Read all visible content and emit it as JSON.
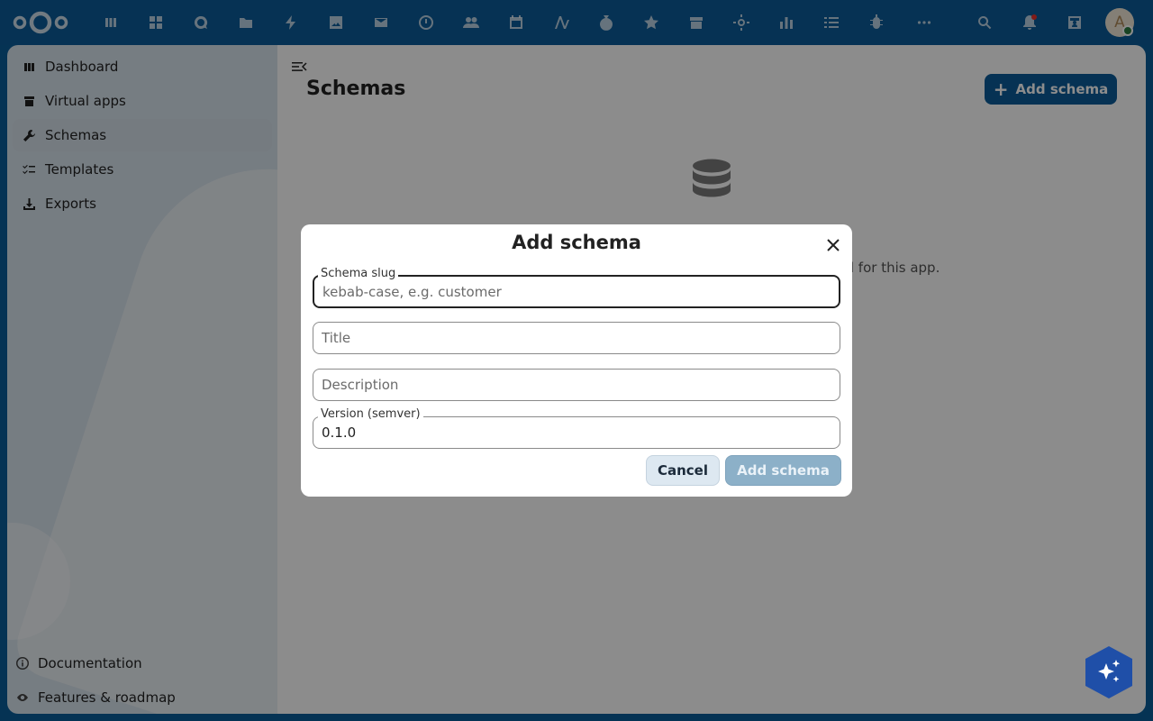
{
  "topbar": {
    "apps": [
      "apps-icon",
      "dashboard-icon",
      "talk-icon",
      "files-icon",
      "activity-icon",
      "photos-icon",
      "mail-icon",
      "deck-icon",
      "contacts-icon",
      "calendar-icon",
      "forms-icon",
      "money-icon",
      "favorites-icon",
      "archive-icon",
      "settings-gear-icon",
      "analytics-icon",
      "tasks-icon",
      "bug-icon",
      "more-icon"
    ],
    "avatar_letter": "A"
  },
  "sidebar": {
    "items": [
      {
        "label": "Dashboard",
        "icon": "dashboard-icon"
      },
      {
        "label": "Virtual apps",
        "icon": "archive-icon"
      },
      {
        "label": "Schemas",
        "icon": "wrench-icon"
      },
      {
        "label": "Templates",
        "icon": "checklist-icon"
      },
      {
        "label": "Exports",
        "icon": "download-icon"
      }
    ],
    "footer": [
      {
        "label": "Documentation",
        "icon": "info-icon"
      },
      {
        "label": "Features & roadmap",
        "icon": "eye-icon"
      }
    ]
  },
  "main": {
    "title": "Schemas",
    "add_button": "Add schema",
    "empty_text_visible": "el for this app."
  },
  "dialog": {
    "title": "Add schema",
    "fields": {
      "slug": {
        "label": "Schema slug",
        "placeholder": "kebab-case, e.g. customer",
        "value": ""
      },
      "title": {
        "placeholder": "Title",
        "value": ""
      },
      "description": {
        "placeholder": "Description",
        "value": ""
      },
      "version": {
        "label": "Version (semver)",
        "value": "0.1.0"
      }
    },
    "cancel_label": "Cancel",
    "submit_label": "Add schema"
  },
  "colors": {
    "brand": "#0b5c99",
    "overlay": "rgba(0,0,0,0.45)",
    "assistant": "#1f4fa8"
  }
}
